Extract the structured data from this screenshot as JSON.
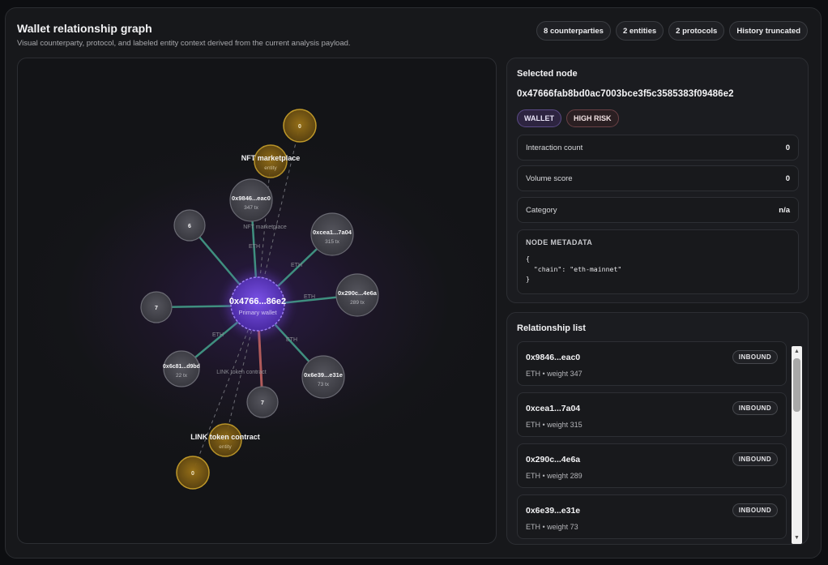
{
  "header": {
    "title": "Wallet relationship graph",
    "subtitle": "Visual counterparty, protocol, and labeled entity context derived from the current analysis payload.",
    "chips": [
      "8 counterparties",
      "2 entities",
      "2 protocols",
      "History truncated"
    ]
  },
  "graph": {
    "center": {
      "label": "0x4766...86e2",
      "sublabel": "Primary wallet"
    },
    "counterparties": [
      {
        "label": "0x9846...eac0",
        "sub": "347 tx"
      },
      {
        "label": "0xcea1...7a04",
        "sub": "315 tx"
      },
      {
        "label": "0x290c...4e6a",
        "sub": "289 tx"
      },
      {
        "label": "0x6e39...e31e",
        "sub": "73 tx"
      },
      {
        "label": "0x6c81...d9bd",
        "sub": "22 tx"
      },
      {
        "label": "7",
        "sub": ""
      },
      {
        "label": "7",
        "sub": ""
      },
      {
        "label": "6",
        "sub": ""
      }
    ],
    "entities": [
      {
        "label": "NFT marketplace",
        "sub": "entity",
        "count": "0"
      },
      {
        "label": "LINK token contract",
        "sub": "entity",
        "count": "0"
      }
    ],
    "edge_labels": [
      "ETH",
      "ETH",
      "ETH",
      "ETH",
      "ETH",
      "NFT marketplace",
      "LINK token contract"
    ]
  },
  "selected": {
    "heading": "Selected node",
    "address": "0x47666fab8bd0ac7003bce3f5c3585383f09486e2",
    "badges": [
      "WALLET",
      "HIGH RISK"
    ],
    "fields": [
      {
        "label": "Interaction count",
        "value": "0"
      },
      {
        "label": "Volume score",
        "value": "0"
      },
      {
        "label": "Category",
        "value": "n/a"
      }
    ],
    "metadata_heading": "NODE METADATA",
    "metadata": "{\n  \"chain\": \"eth-mainnet\"\n}"
  },
  "relationships": {
    "heading": "Relationship list",
    "items": [
      {
        "address": "0x9846...eac0",
        "detail": "ETH • weight 347",
        "direction": "INBOUND"
      },
      {
        "address": "0xcea1...7a04",
        "detail": "ETH • weight 315",
        "direction": "INBOUND"
      },
      {
        "address": "0x290c...4e6a",
        "detail": "ETH • weight 289",
        "direction": "INBOUND"
      },
      {
        "address": "0x6e39...e31e",
        "detail": "ETH • weight 73",
        "direction": "INBOUND"
      }
    ]
  },
  "colors": {
    "edge_eth": "#3f8f7f",
    "edge_risk": "#b05a5a",
    "center_node": "#6a3fd0",
    "entity_node": "#a07a1c",
    "counterparty_node": "#4a4a52"
  }
}
